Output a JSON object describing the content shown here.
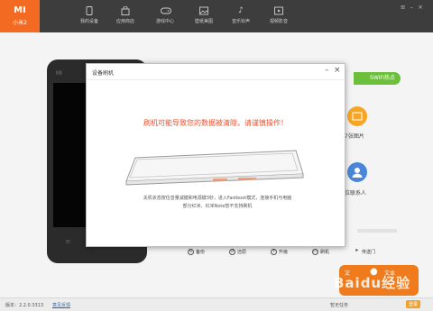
{
  "app": {
    "brand_logo": "MI",
    "brand_name": "小米2"
  },
  "nav": [
    {
      "label": "我的设备",
      "icon": "phone-icon"
    },
    {
      "label": "应用商店",
      "icon": "shopping-bag-icon"
    },
    {
      "label": "游戏中心",
      "icon": "gamepad-icon"
    },
    {
      "label": "壁纸美图",
      "icon": "picture-icon"
    },
    {
      "label": "音乐铃声",
      "icon": "music-note-icon"
    },
    {
      "label": "视频影音",
      "icon": "video-play-icon"
    }
  ],
  "phone": {
    "logo": "MI"
  },
  "right_panel": {
    "wifi_label": "SWiFi热点",
    "photos_label": "7张图片",
    "contacts_label": "位联系人"
  },
  "toolbar": [
    {
      "label": "备份",
      "icon": "backup-icon"
    },
    {
      "label": "还原",
      "icon": "restore-icon"
    },
    {
      "label": "升级",
      "icon": "upgrade-icon"
    },
    {
      "label": "刷机",
      "icon": "flash-icon"
    },
    {
      "label": "传送门",
      "icon": "send-icon"
    }
  ],
  "promo": {
    "text_left": "文",
    "text_right": "文本"
  },
  "watermark": "Baidu经验",
  "dialog": {
    "title": "设备刷机",
    "warning": "刷机可能导致您的数据被清除，请谨慎操作！",
    "instruction_line1": "关机状态按住音量减键和电源键3秒，进入Fastboot模式，连接手机与电脑",
    "instruction_line2": "部分红米、红米Note暂不支持刷机"
  },
  "status_bar": {
    "version": "版本：2.2.0.3313",
    "feedback": "意见反馈",
    "notice": "暂无任务",
    "login": "登录"
  },
  "colors": {
    "accent": "#f36a22",
    "warning": "#e8512f",
    "wifi": "#6cbf3a",
    "topbar": "#3d3d3d"
  }
}
